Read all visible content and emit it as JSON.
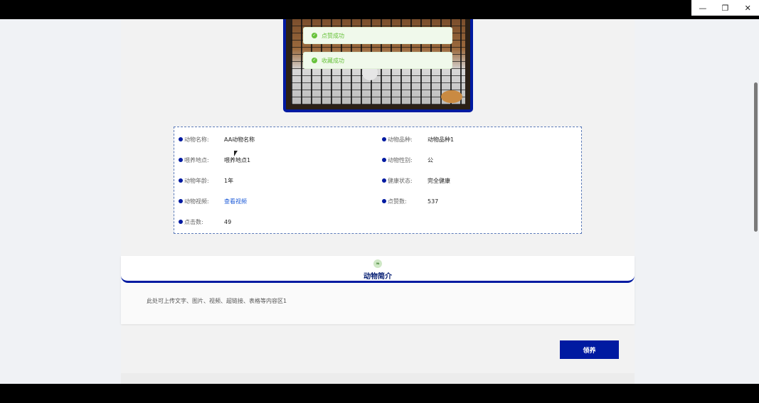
{
  "window": {
    "controls": {
      "minimize": "—",
      "restore": "❐",
      "close": "✕"
    }
  },
  "toasts": [
    {
      "text": "点赞成功"
    },
    {
      "text": "收藏成功"
    }
  ],
  "info": {
    "animal_name": {
      "label": "动物名称:",
      "value": "AA动物名称"
    },
    "species": {
      "label": "动物品种:",
      "value": "动物品种1"
    },
    "location": {
      "label": "喂养地点:",
      "value": "喂养地点1"
    },
    "gender": {
      "label": "动物性别:",
      "value": "公"
    },
    "age": {
      "label": "动物年龄:",
      "value": "1年"
    },
    "health": {
      "label": "健康状态:",
      "value": "完全健康"
    },
    "video": {
      "label": "动物视频:",
      "value": "查看视频"
    },
    "likes": {
      "label": "点赞数:",
      "value": "537"
    },
    "clicks": {
      "label": "点击数:",
      "value": "49"
    }
  },
  "intro": {
    "title": "动物简介",
    "text": "此处可上传文字、图片、视频、超链接、表格等内容区1"
  },
  "actions": {
    "adopt_label": "领养"
  },
  "colors": {
    "accent": "#001aa1",
    "success": "#67c23a",
    "link": "#1d5bd8"
  }
}
